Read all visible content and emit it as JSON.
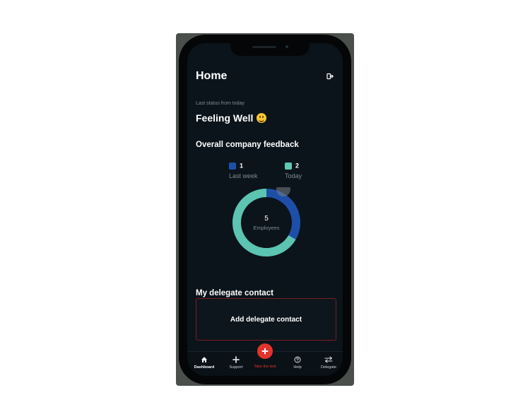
{
  "header": {
    "title": "Home",
    "logout_icon": "logout-icon"
  },
  "status": {
    "label": "Last status from today",
    "feeling": "Feeling Well",
    "emoji": "smiling-face-icon"
  },
  "feedback": {
    "title": "Overall company feedback",
    "legend": [
      {
        "value": "1",
        "label": "Last week",
        "color": "#1e4fa8"
      },
      {
        "value": "2",
        "label": "Today",
        "color": "#5fc7b5"
      }
    ],
    "center_value": "5",
    "center_label": "Employees"
  },
  "chart_data": {
    "type": "pie",
    "donut": true,
    "categories": [
      "Last week",
      "Today"
    ],
    "values": [
      1,
      2
    ],
    "colors": [
      "#1e4fa8",
      "#5fc7b5"
    ]
  },
  "delegate": {
    "title": "My delegate contact",
    "add_label": "Add delegate contact"
  },
  "nav": {
    "items": [
      {
        "label": "Dashboard",
        "icon": "home-icon"
      },
      {
        "label": "Support",
        "icon": "plus-icon"
      },
      {
        "label": "Take the test",
        "icon": "add-circle-icon"
      },
      {
        "label": "Help",
        "icon": "help-circle-icon"
      },
      {
        "label": "Delegate",
        "icon": "swap-arrows-icon"
      }
    ]
  },
  "colors": {
    "background": "#0b141b",
    "accent": "#e2342b",
    "muted": "#7d8a93"
  }
}
